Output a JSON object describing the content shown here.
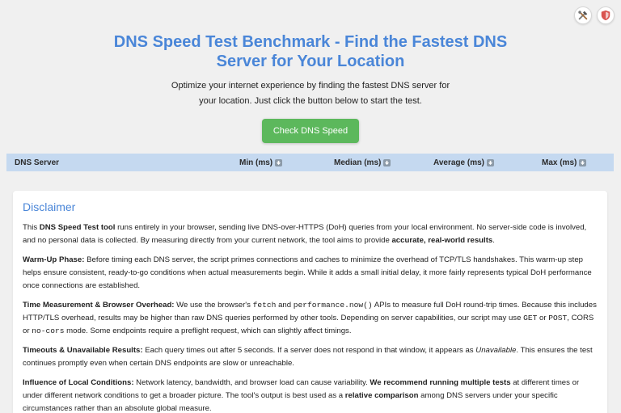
{
  "top_icons": [
    "tools-icon",
    "shield-icon"
  ],
  "colors": {
    "title": "#4a86d8",
    "button": "#5cb85c",
    "table_header_bg": "#c5d9f0",
    "page_bg": "#f0f0f0"
  },
  "hero": {
    "title": "DNS Speed Test Benchmark - Find the Fastest DNS Server for Your Location",
    "subtitle": "Optimize your internet experience by finding the fastest DNS server for your location. Just click the button below to start the test.",
    "button_label": "Check DNS Speed"
  },
  "table": {
    "columns": [
      {
        "label": "DNS Server",
        "sortable": false
      },
      {
        "label": "Min (ms)",
        "sortable": true
      },
      {
        "label": "Median (ms)",
        "sortable": true
      },
      {
        "label": "Average (ms)",
        "sortable": true
      },
      {
        "label": "Max (ms)",
        "sortable": true
      }
    ]
  },
  "disclaimer": {
    "heading": "Disclaimer",
    "p1": {
      "t1": "This ",
      "b1": "DNS Speed Test tool",
      "t2": " runs entirely in your browser, sending live DNS-over-HTTPS (DoH) queries from your local environment. No server-side code is involved, and no personal data is collected. By measuring directly from your current network, the tool aims to provide ",
      "b2": "accurate, real-world results",
      "t3": "."
    },
    "p2": {
      "b1": "Warm-Up Phase:",
      "t1": " Before timing each DNS server, the script primes connections and caches to minimize the overhead of TCP/TLS handshakes. This warm-up step helps ensure consistent, ready-to-go conditions when actual measurements begin. While it adds a small initial delay, it more fairly represents typical DoH performance once connections are established."
    },
    "p3": {
      "b1": "Time Measurement & Browser Overhead:",
      "t1": " We use the browser's ",
      "c1": "fetch",
      "t2": " and ",
      "c2": "performance.now()",
      "t3": " APIs to measure full DoH round-trip times. Because this includes HTTP/TLS overhead, results may be higher than raw DNS queries performed by other tools. Depending on server capabilities, our script may use ",
      "c3": "GET",
      "t4": " or ",
      "c4": "POST",
      "t5": ", CORS or ",
      "c5": "no-cors",
      "t6": " mode. Some endpoints require a preflight request, which can slightly affect timings."
    },
    "p4": {
      "b1": "Timeouts & Unavailable Results:",
      "t1": " Each query times out after 5 seconds. If a server does not respond in that window, it appears as ",
      "i1": "Unavailable",
      "t2": ". This ensures the test continues promptly even when certain DNS endpoints are slow or unreachable."
    },
    "p5": {
      "b1": "Influence of Local Conditions:",
      "t1": " Network latency, bandwidth, and browser load can cause variability. ",
      "b2": "We recommend running multiple tests",
      "t2": " at different times or under different network conditions to get a broader picture. The tool's output is best used as a ",
      "b3": "relative comparison",
      "t3": " among DNS servers under your specific circumstances rather than an absolute global measure."
    }
  }
}
